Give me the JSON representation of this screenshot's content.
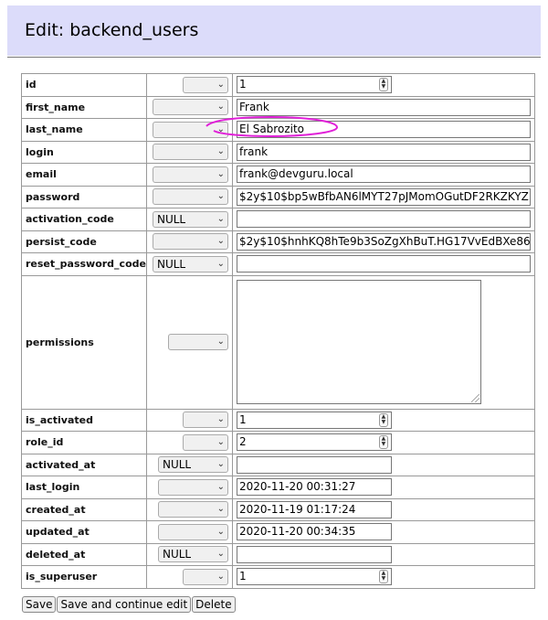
{
  "page": {
    "title": "Edit: backend_users"
  },
  "fields": [
    {
      "name": "id",
      "func": "",
      "value": "1",
      "input": "number"
    },
    {
      "name": "first_name",
      "func": "",
      "value": "Frank",
      "input": "text"
    },
    {
      "name": "last_name",
      "func": "",
      "value": "El Sabrozito",
      "input": "text"
    },
    {
      "name": "login",
      "func": "",
      "value": "frank",
      "input": "text"
    },
    {
      "name": "email",
      "func": "",
      "value": "frank@devguru.local",
      "input": "text"
    },
    {
      "name": "password",
      "func": "",
      "value": "$2y$10$bp5wBfbAN6lMYT27pJMomOGutDF2RKZKYZ",
      "input": "text"
    },
    {
      "name": "activation_code",
      "func": "NULL",
      "value": "",
      "input": "text"
    },
    {
      "name": "persist_code",
      "func": "",
      "value": "$2y$10$hnhKQ8hTe9b3SoZgXhBuT.HG17VvEdBXe86",
      "input": "text"
    },
    {
      "name": "reset_password_code",
      "func": "NULL",
      "value": "",
      "input": "text"
    },
    {
      "name": "permissions",
      "func": "",
      "value": "",
      "input": "textarea"
    },
    {
      "name": "is_activated",
      "func": "",
      "value": "1",
      "input": "number"
    },
    {
      "name": "role_id",
      "func": "",
      "value": "2",
      "input": "number"
    },
    {
      "name": "activated_at",
      "func": "NULL",
      "value": "",
      "input": "datetime"
    },
    {
      "name": "last_login",
      "func": "",
      "value": "2020-11-20 00:31:27",
      "input": "datetime"
    },
    {
      "name": "created_at",
      "func": "",
      "value": "2020-11-19 01:17:24",
      "input": "datetime"
    },
    {
      "name": "updated_at",
      "func": "",
      "value": "2020-11-20 00:34:35",
      "input": "datetime"
    },
    {
      "name": "deleted_at",
      "func": "NULL",
      "value": "",
      "input": "datetime"
    },
    {
      "name": "is_superuser",
      "func": "",
      "value": "1",
      "input": "number"
    }
  ],
  "buttons": {
    "save": "Save",
    "save_continue": "Save and continue edit",
    "delete": "Delete"
  },
  "colors": {
    "header_bg": "#dcdcfa",
    "highlight": "#e020d8"
  }
}
